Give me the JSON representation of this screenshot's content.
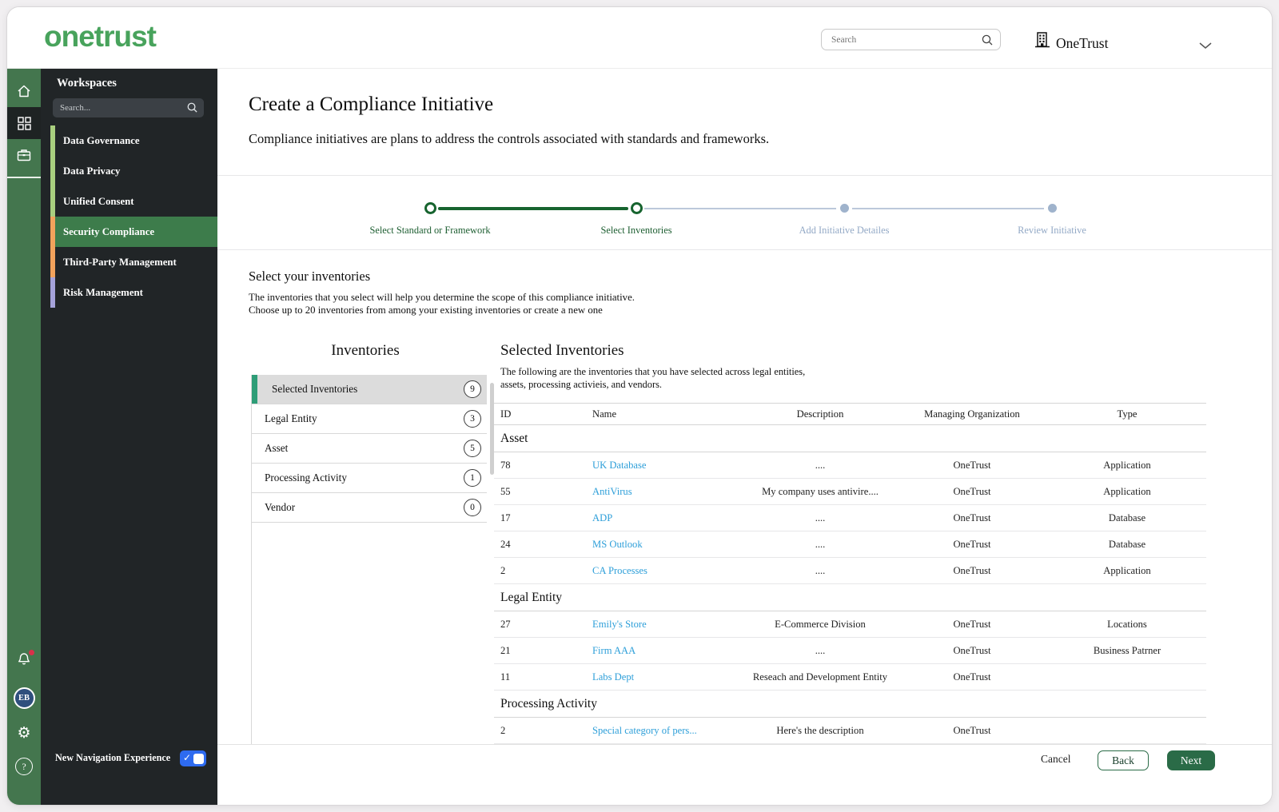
{
  "header": {
    "logo_text": "onetrust",
    "search_placeholder": "Search",
    "org_name": "OneTrust"
  },
  "rail": {
    "avatar_initials": "EB",
    "icons": [
      "home-icon",
      "apps-grid-icon",
      "briefcase-icon",
      "bell-icon",
      "avatar",
      "gear-icon",
      "help-icon"
    ]
  },
  "sidebar": {
    "title": "Workspaces",
    "search_placeholder": "Search...",
    "items": [
      {
        "label": "Data Governance",
        "strip_color": "#a9cf7f",
        "active": false
      },
      {
        "label": "Data Privacy",
        "strip_color": "#a9cf7f",
        "active": false
      },
      {
        "label": "Unified Consent",
        "strip_color": "#a9cf7f",
        "active": false
      },
      {
        "label": "Security Compliance",
        "strip_color": "#f2a35c",
        "active": true
      },
      {
        "label": "Third-Party Management",
        "strip_color": "#f2a35c",
        "active": false
      },
      {
        "label": "Risk Management",
        "strip_color": "#a5a3da",
        "active": false
      }
    ],
    "new_nav_label": "New Navigation Experience",
    "toggle_on": true
  },
  "page": {
    "title": "Create a Compliance Initiative",
    "subtitle": "Compliance initiatives are plans to address the controls associated with standards and frameworks."
  },
  "stepper": {
    "steps": [
      {
        "label": "Select Standard or Framework",
        "state": "done"
      },
      {
        "label": "Select Inventories",
        "state": "current"
      },
      {
        "label": "Add Initiative Detailes",
        "state": "upcoming"
      },
      {
        "label": "Review Initiative",
        "state": "upcoming"
      }
    ]
  },
  "section": {
    "title": "Select your inventories",
    "line1": "The inventories that you select will help you determine the scope of this compliance initiative.",
    "line2": "Choose up to 20 inventories from among your existing inventories or create a new one"
  },
  "inventories": {
    "title": "Inventories",
    "items": [
      {
        "label": "Selected Inventories",
        "count": "9",
        "active": true
      },
      {
        "label": "Legal Entity",
        "count": "3",
        "active": false
      },
      {
        "label": "Asset",
        "count": "5",
        "active": false
      },
      {
        "label": "Processing Activity",
        "count": "1",
        "active": false
      },
      {
        "label": "Vendor",
        "count": "0",
        "active": false
      }
    ]
  },
  "selected": {
    "title": "Selected Inventories",
    "desc1": "The following are the inventories that you have selected across legal entities,",
    "desc2": "assets, processing activieis, and vendors.",
    "columns": [
      "ID",
      "Name",
      "Description",
      "Managing Organization",
      "Type"
    ],
    "groups": [
      {
        "name": "Asset",
        "rows": [
          [
            "78",
            "UK Database",
            "....",
            "OneTrust",
            "Application"
          ],
          [
            "55",
            "AntiVirus",
            "My company uses antivire....",
            "OneTrust",
            "Application"
          ],
          [
            "17",
            "ADP",
            "....",
            "OneTrust",
            "Database"
          ],
          [
            "24",
            "MS Outlook",
            "....",
            "OneTrust",
            "Database"
          ],
          [
            "2",
            "CA Processes",
            "....",
            "OneTrust",
            "Application"
          ]
        ]
      },
      {
        "name": "Legal Entity",
        "rows": [
          [
            "27",
            "Emily's Store",
            "E-Commerce Division",
            "OneTrust",
            "Locations"
          ],
          [
            "21",
            "Firm AAA",
            "....",
            "OneTrust",
            "Business Patrner"
          ],
          [
            "11",
            "Labs Dept",
            "Reseach and Development Entity",
            "OneTrust",
            ""
          ]
        ]
      },
      {
        "name": "Processing Activity",
        "rows": [
          [
            "2",
            "Special category of pers...",
            "Here's the description",
            "OneTrust",
            ""
          ]
        ]
      }
    ]
  },
  "footer": {
    "cancel": "Cancel",
    "back": "Back",
    "next": "Next"
  },
  "colors": {
    "brand_green": "#48a35c",
    "rail_green": "#44764e",
    "sidebar_dark": "#212527",
    "active_item_green": "#3d7c4b",
    "stepper_green": "#17642f",
    "stepper_gray": "#9fb3cc",
    "link_blue": "#2e9fd9",
    "button_green": "#2a6b47",
    "toggle_blue": "#2e6bf0",
    "selected_strip_green": "#2e9d77",
    "avatar_navy": "#2f4f7d",
    "notification_red": "#d9304a"
  }
}
